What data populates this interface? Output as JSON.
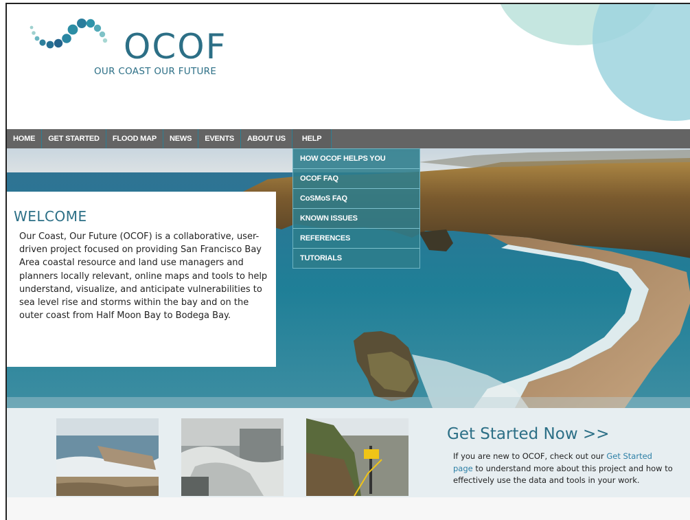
{
  "logo": {
    "text": "OCOF",
    "subtitle": "OUR COAST OUR FUTURE"
  },
  "nav": {
    "items": [
      {
        "label": "HOME"
      },
      {
        "label": "GET STARTED"
      },
      {
        "label": "FLOOD MAP"
      },
      {
        "label": "NEWS"
      },
      {
        "label": "EVENTS"
      },
      {
        "label": "ABOUT US"
      },
      {
        "label": "HELP"
      }
    ],
    "active": "HELP"
  },
  "help_menu": {
    "items": [
      {
        "label": "HOW OCOF HELPS YOU"
      },
      {
        "label": "OCOF FAQ"
      },
      {
        "label": "CoSMoS FAQ"
      },
      {
        "label": "KNOWN ISSUES"
      },
      {
        "label": "REFERENCES"
      },
      {
        "label": "TUTORIALS"
      }
    ]
  },
  "welcome": {
    "title": "WELCOME",
    "body": "Our Coast, Our Future (OCOF) is a collaborative, user-driven project focused on providing San Francisco Bay Area coastal resource and land use managers and planners locally relevant, online maps and tools to help understand, visualize, and anticipate vulnerabilities to sea level rise and storms within the bay and on the outer coast from Half Moon Bay to Bodega Bay."
  },
  "get_started": {
    "title": "Get Started Now >>",
    "text_before": "If you are new to OCOF, check out our ",
    "link": "Get Started page",
    "text_after": " to understand more about this project and how to effectively use the data and tools in your work."
  },
  "colors": {
    "brand": "#2c6f86",
    "nav_bg": "#646464",
    "menu_bg": "#2e7d8c",
    "link": "#2c7fa6"
  }
}
